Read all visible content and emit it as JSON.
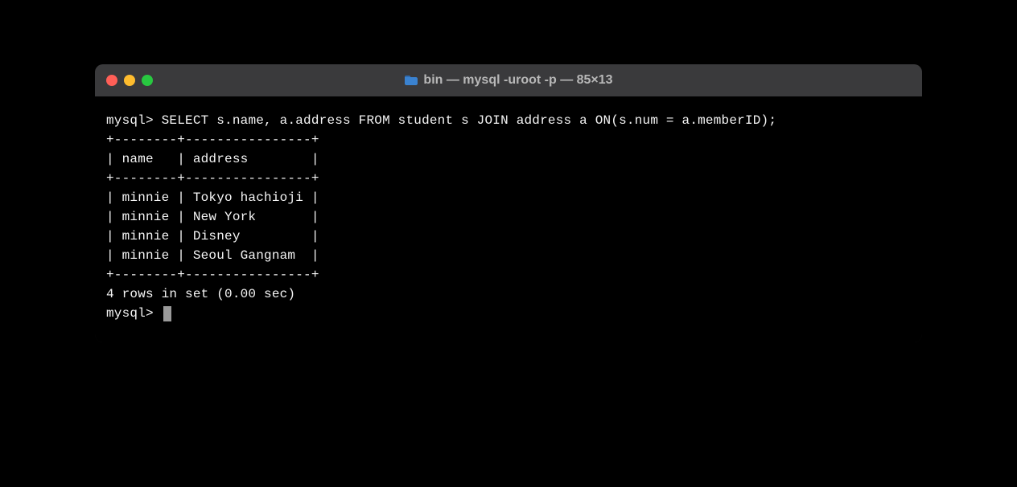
{
  "window": {
    "title": "bin — mysql -uroot -p — 85×13"
  },
  "terminal": {
    "prompt1": "mysql> ",
    "query": "SELECT s.name, a.address FROM student s JOIN address a ON(s.num = a.memberID);",
    "table_border": "+--------+----------------+",
    "header_line": "| name   | address        |",
    "rows": [
      "| minnie | Tokyo hachioji |",
      "| minnie | New York       |",
      "| minnie | Disney         |",
      "| minnie | Seoul Gangnam  |"
    ],
    "result_status": "4 rows in set (0.00 sec)",
    "prompt2": "mysql> "
  },
  "table_data": {
    "columns": [
      "name",
      "address"
    ],
    "rows": [
      {
        "name": "minnie",
        "address": "Tokyo hachioji"
      },
      {
        "name": "minnie",
        "address": "New York"
      },
      {
        "name": "minnie",
        "address": "Disney"
      },
      {
        "name": "minnie",
        "address": "Seoul Gangnam"
      }
    ],
    "row_count": 4,
    "exec_time_sec": 0.0
  }
}
